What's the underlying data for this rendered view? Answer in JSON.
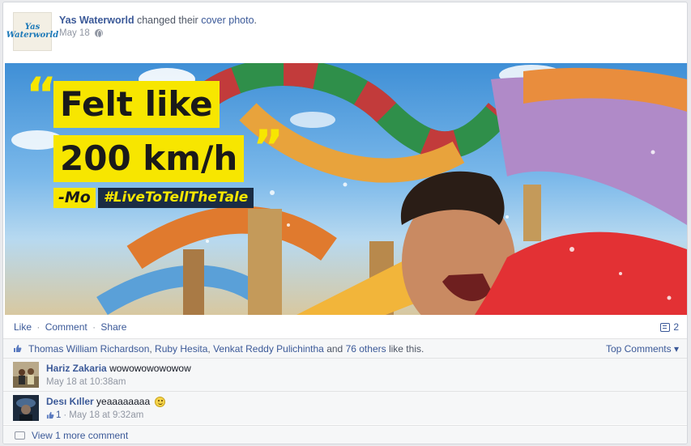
{
  "post": {
    "actor": "Yas Waterworld",
    "action_prefix": "changed their",
    "action_link": "cover photo",
    "action_suffix": ".",
    "date": "May 18",
    "page_logo_text": "Yas Waterworld"
  },
  "cover": {
    "headline_line1": "Felt like",
    "headline_line2": "200 km/h",
    "signature": "-Mo",
    "hashtag": "#LiveToTellTheTale",
    "quote_open": "“",
    "quote_close": "”",
    "accent_color": "#f7e600"
  },
  "actions": {
    "like": "Like",
    "comment": "Comment",
    "share": "Share",
    "separator": "·",
    "comment_count": "2"
  },
  "likes": {
    "names": [
      "Thomas William Richardson",
      "Ruby Hesita",
      "Venkat Reddy Pulichintha"
    ],
    "and_text": "and",
    "others_link": "76 others",
    "suffix": "like this.",
    "top_comments": "Top Comments ▾"
  },
  "comments": [
    {
      "author": "Hariz Zakaria",
      "text": "wowowowowowow",
      "time": "May 18 at 10:38am",
      "likes": ""
    },
    {
      "author": "Desı Kıller",
      "text": "yeaaaaaaaa",
      "time": "May 18 at 9:32am",
      "likes": "1"
    }
  ],
  "more": {
    "label": "View 1 more comment"
  },
  "colors": {
    "link": "#3b5998",
    "meta": "#9197a3"
  }
}
